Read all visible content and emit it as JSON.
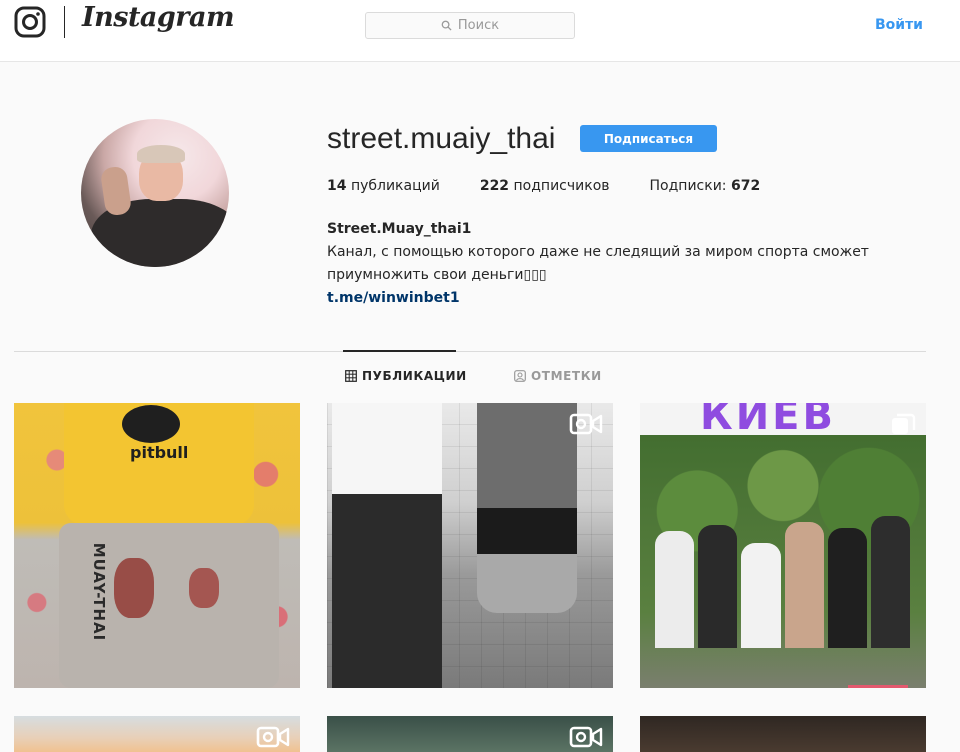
{
  "header": {
    "brand": "Instagram",
    "search_placeholder": "Поиск",
    "login_label": "Войти"
  },
  "profile": {
    "username": "street.muaiy_thai",
    "follow_label": "Подписаться",
    "stats": {
      "posts_value": "14",
      "posts_label": "публикаций",
      "followers_value": "222",
      "followers_label": "подписчиков",
      "following_label": "Подписки:",
      "following_value": "672"
    },
    "bio": {
      "name": "Street.Muay_thai1",
      "text": "Канал, с помощью которого даже не следящий за миром спорта сможет приумножить свои деньги▯▯▯",
      "link": "t.me/winwinbet1"
    }
  },
  "tabs": {
    "posts_label": "ПУБЛИКАЦИИ",
    "tagged_label": "ОТМЕТКИ"
  },
  "posts": [
    {
      "shirt_text": "pitbull",
      "side_text": "MUAY-THAI",
      "overlay_icon": "none"
    },
    {
      "overlay_icon": "video-icon"
    },
    {
      "banner_text": "КИЕВ",
      "overlay_icon": "carousel-icon"
    },
    {
      "overlay_icon": "video-icon"
    },
    {
      "overlay_icon": "video-icon"
    },
    {
      "overlay_icon": "none"
    }
  ],
  "colors": {
    "accent": "#3897f0",
    "link": "#003569",
    "text": "#262626",
    "muted": "#999999"
  }
}
